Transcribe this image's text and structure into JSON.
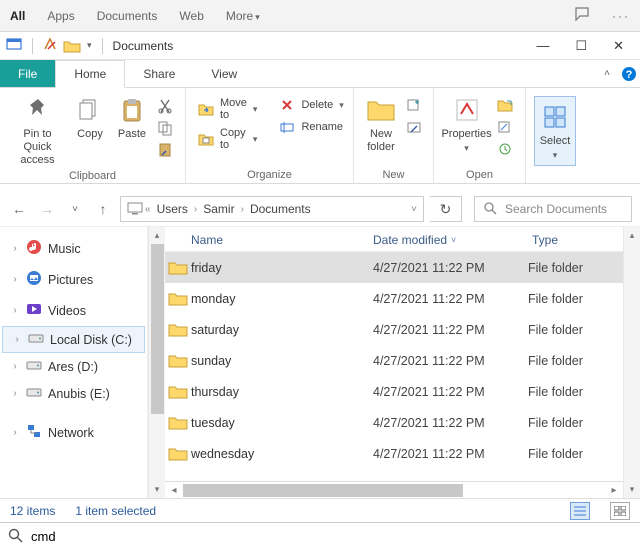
{
  "topbar": {
    "all": "All",
    "apps": "Apps",
    "documents": "Documents",
    "web": "Web",
    "more": "More"
  },
  "title": "Documents",
  "tabs": {
    "file": "File",
    "home": "Home",
    "share": "Share",
    "view": "View"
  },
  "ribbon": {
    "pin": "Pin to Quick\naccess",
    "copy": "Copy",
    "paste": "Paste",
    "moveTo": "Move to",
    "copyTo": "Copy to",
    "delete": "Delete",
    "rename": "Rename",
    "newFolder": "New\nfolder",
    "properties": "Properties",
    "select": "Select",
    "groups": {
      "clipboard": "Clipboard",
      "organize": "Organize",
      "new": "New",
      "open": "Open"
    }
  },
  "breadcrumbs": [
    "Users",
    "Samir",
    "Documents"
  ],
  "search": {
    "placeholder": "Search Documents"
  },
  "sidebar": {
    "items": [
      {
        "label": "Music"
      },
      {
        "label": "Pictures"
      },
      {
        "label": "Videos"
      },
      {
        "label": "Local Disk (C:)"
      },
      {
        "label": "Ares (D:)"
      },
      {
        "label": "Anubis (E:)"
      },
      {
        "label": "Network"
      }
    ]
  },
  "columns": {
    "name": "Name",
    "date": "Date modified",
    "type": "Type"
  },
  "files": [
    {
      "name": "friday",
      "date": "4/27/2021 11:22 PM",
      "type": "File folder"
    },
    {
      "name": "monday",
      "date": "4/27/2021 11:22 PM",
      "type": "File folder"
    },
    {
      "name": "saturday",
      "date": "4/27/2021 11:22 PM",
      "type": "File folder"
    },
    {
      "name": "sunday",
      "date": "4/27/2021 11:22 PM",
      "type": "File folder"
    },
    {
      "name": "thursday",
      "date": "4/27/2021 11:22 PM",
      "type": "File folder"
    },
    {
      "name": "tuesday",
      "date": "4/27/2021 11:22 PM",
      "type": "File folder"
    },
    {
      "name": "wednesday",
      "date": "4/27/2021 11:22 PM",
      "type": "File folder"
    }
  ],
  "status": {
    "items": "12 items",
    "selected": "1 item selected"
  },
  "cmd": {
    "value": "cmd"
  }
}
